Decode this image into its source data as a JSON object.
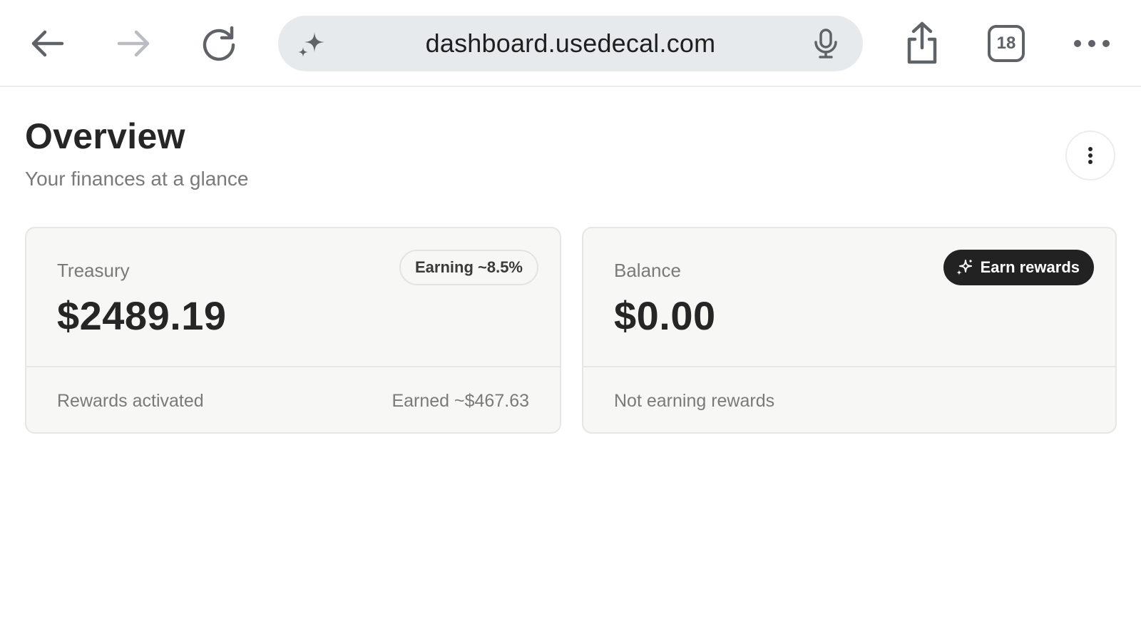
{
  "browser": {
    "url": "dashboard.usedecal.com",
    "tab_count": "18",
    "icons": {
      "back": "arrow-left-icon",
      "forward": "arrow-right-icon",
      "reload": "reload-icon",
      "sparkle": "sparkle-icon",
      "mic": "microphone-icon",
      "share": "share-icon",
      "tabs": "tabs-icon",
      "more": "more-horizontal-icon"
    }
  },
  "page": {
    "title": "Overview",
    "subtitle": "Your finances at a glance"
  },
  "cards": {
    "treasury": {
      "label": "Treasury",
      "amount": "$2489.19",
      "badge": "Earning ~8.5%",
      "footer_left": "Rewards activated",
      "footer_right": "Earned ~$467.63"
    },
    "balance": {
      "label": "Balance",
      "amount": "$0.00",
      "action": "Earn rewards",
      "footer_left": "Not earning rewards"
    }
  },
  "colors": {
    "card_bg": "#f7f7f6",
    "badge_dark": "#222222",
    "text_muted": "#7a7a7a",
    "url_bar": "#e7eaed"
  }
}
